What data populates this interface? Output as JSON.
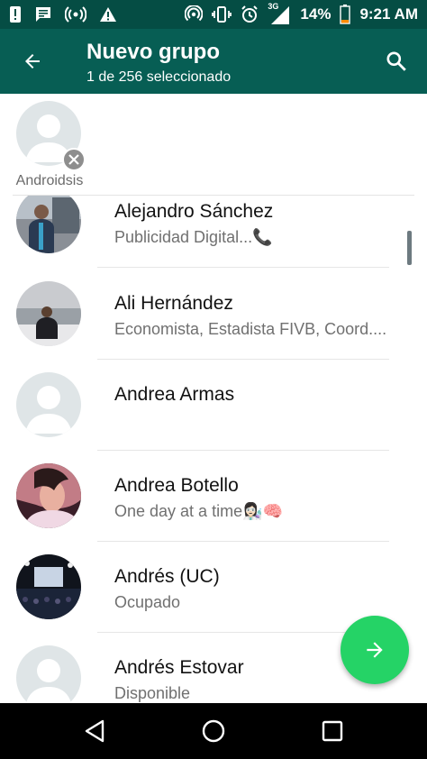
{
  "status_bar": {
    "network_type": "3G",
    "battery_percent": "14%",
    "time": "9:21 AM",
    "icons": [
      "notification-icon",
      "message-icon",
      "radio-icon",
      "warning-icon",
      "hotspot-icon",
      "vibrate-icon",
      "alarm-icon",
      "signal-icon",
      "battery-icon"
    ]
  },
  "app_bar": {
    "title": "Nuevo grupo",
    "subtitle": "1 de 256 seleccionado",
    "back_icon": "arrow-back-icon",
    "search_icon": "search-icon",
    "color": "#075e54"
  },
  "selected": [
    {
      "name": "Androidsis",
      "remove_icon": "close-icon"
    }
  ],
  "contacts": [
    {
      "name": "Alejandro Sánchez",
      "status": "Publicidad Digital...📞",
      "avatar": "photo"
    },
    {
      "name": "Ali Hernández",
      "status": "Economista, Estadista FIVB, Coord....",
      "avatar": "photo"
    },
    {
      "name": "Andrea Armas",
      "status": "",
      "avatar": "default"
    },
    {
      "name": "Andrea Botello",
      "status": "One day at a time👩🏻‍🔬🧠",
      "avatar": "photo"
    },
    {
      "name": "Andrés (UC)",
      "status": "Ocupado",
      "avatar": "photo"
    },
    {
      "name": "Andrés Estovar",
      "status": "Disponible",
      "avatar": "default"
    }
  ],
  "fab": {
    "icon": "arrow-forward-icon",
    "color": "#25d366"
  },
  "nav_bar": {
    "icons": [
      "back-triangle-icon",
      "home-circle-icon",
      "recents-square-icon"
    ]
  }
}
